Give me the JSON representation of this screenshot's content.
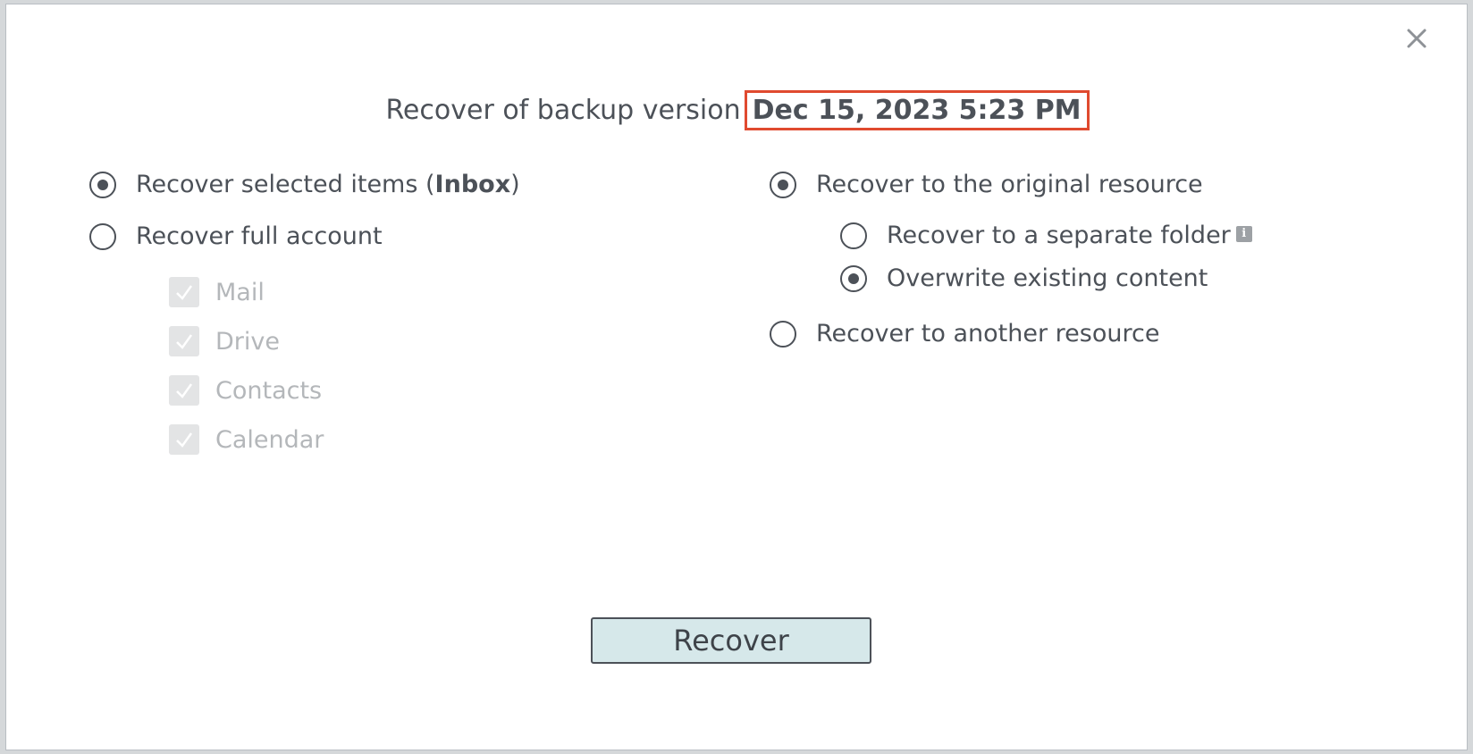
{
  "dialog": {
    "title_prefix": "Recover of backup version",
    "version_date": "Dec 15, 2023 5:23 PM"
  },
  "left_options": {
    "selected_items": {
      "label_prefix": "Recover selected items (",
      "label_bold": "Inbox",
      "label_suffix": ")",
      "checked": true
    },
    "full_account": {
      "label": "Recover full account",
      "checked": false
    },
    "components": [
      {
        "label": "Mail",
        "checked": true,
        "disabled": true
      },
      {
        "label": "Drive",
        "checked": true,
        "disabled": true
      },
      {
        "label": "Contacts",
        "checked": true,
        "disabled": true
      },
      {
        "label": "Calendar",
        "checked": true,
        "disabled": true
      }
    ]
  },
  "right_options": {
    "original_resource": {
      "label": "Recover to the original resource",
      "checked": true
    },
    "separate_folder": {
      "label": "Recover to a separate folder",
      "checked": false
    },
    "overwrite": {
      "label": "Overwrite existing content",
      "checked": true
    },
    "another_resource": {
      "label": "Recover to another resource",
      "checked": false
    }
  },
  "actions": {
    "recover_label": "Recover"
  },
  "icons": {
    "close": "close-icon",
    "info": "info-icon",
    "check": "checkmark-icon"
  },
  "colors": {
    "highlight_border": "#e04a2f",
    "button_bg": "#d6e8ea",
    "text": "#4c5158",
    "disabled_text": "#b4b7ba"
  }
}
